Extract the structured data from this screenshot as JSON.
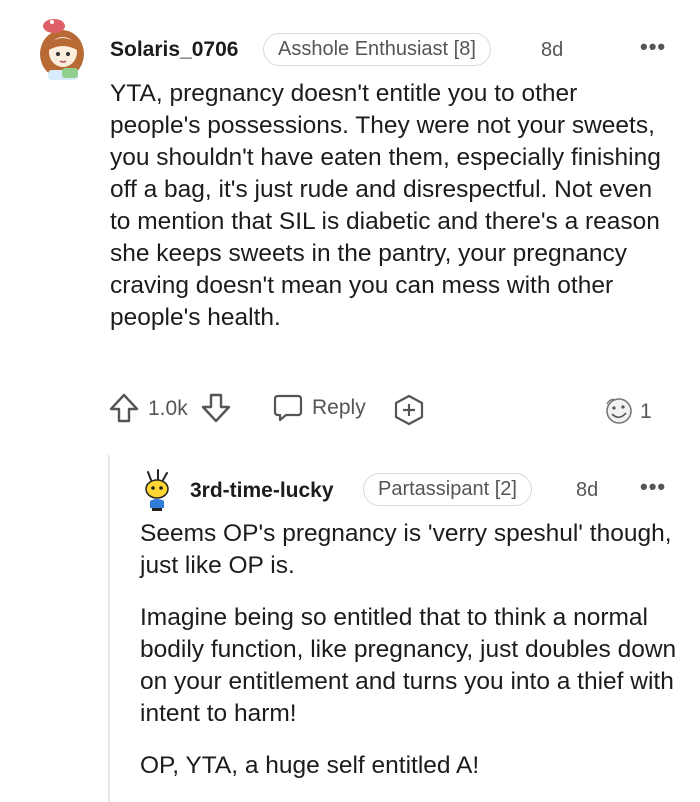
{
  "comment": {
    "username": "Solaris_0706",
    "flair": "Asshole Enthusiast [8]",
    "age": "8d",
    "more_icon": "ellipsis-icon",
    "body": "YTA, pregnancy doesn't entitle you to other people's possessions. They were not your sweets, you shouldn't have eaten them, especially finishing off a bag, it's just rude and disrespectful. Not even to mention that SIL is diabetic and there's a reason she keeps sweets in the pantry, your pregnancy craving doesn't mean you can mess with other people's health.",
    "votes": "1.0k",
    "reply_label": "Reply",
    "award_count": "1"
  },
  "reply": {
    "username": "3rd-time-lucky",
    "flair": "Partassipant [2]",
    "age": "8d",
    "paragraphs": [
      "Seems OP's pregnancy is 'verry speshul' though, just like OP is.",
      "Imagine being so entitled that to think a normal bodily function, like pregnancy, just doubles down on your entitlement and turns you into a thief with intent to harm!",
      "OP, YTA, a huge self entitled A!"
    ]
  },
  "colors": {
    "text": "#1c1c1c",
    "muted": "#555555",
    "border": "#d9d9d9"
  }
}
